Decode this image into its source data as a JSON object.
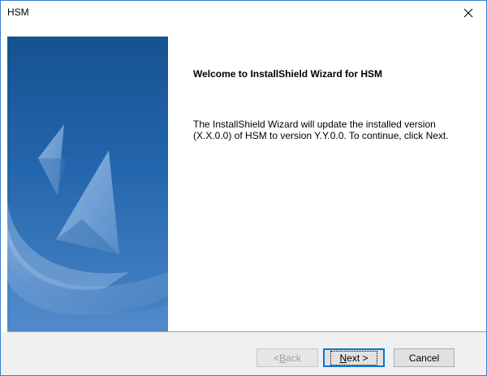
{
  "window": {
    "title": "HSM"
  },
  "icons": {
    "close": "close-icon",
    "banner": "installshield-banner-graphic"
  },
  "content": {
    "heading": "Welcome to InstallShield Wizard for HSM",
    "body": "The InstallShield Wizard will update the installed version (X.X.0.0) of HSM to version Y.Y.0.0. To continue, click Next."
  },
  "buttons": {
    "back": {
      "prefix": "< ",
      "mnemonic": "B",
      "rest": "ack",
      "enabled": false
    },
    "next": {
      "mnemonic": "N",
      "rest": "ext >",
      "enabled": true,
      "default": true
    },
    "cancel": {
      "label": "Cancel",
      "enabled": true
    }
  },
  "colors": {
    "banner_top": "#1a5a9e",
    "banner_bottom": "#3c7bc2",
    "window_border": "#3a7fcf",
    "default_button_border": "#0078d7",
    "footer_bg": "#f0f0f0"
  }
}
